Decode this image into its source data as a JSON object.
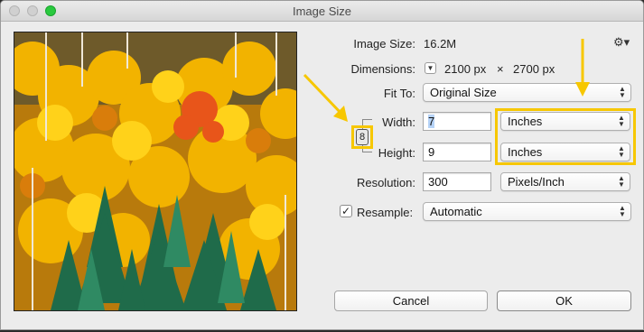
{
  "window": {
    "title": "Image Size"
  },
  "info": {
    "image_size_label": "Image Size:",
    "image_size_value": "16.2M",
    "dimensions_label": "Dimensions:",
    "dimensions_width": "2100 px",
    "dimensions_times": "×",
    "dimensions_height": "2700 px"
  },
  "fit_to": {
    "label": "Fit To:",
    "value": "Original Size"
  },
  "width": {
    "label": "Width:",
    "value": "7",
    "unit": "Inches"
  },
  "height": {
    "label": "Height:",
    "value": "9",
    "unit": "Inches"
  },
  "resolution": {
    "label": "Resolution:",
    "value": "300",
    "unit": "Pixels/Inch"
  },
  "resample": {
    "label": "Resample:",
    "checked": true,
    "value": "Automatic"
  },
  "buttons": {
    "cancel": "Cancel",
    "ok": "OK"
  },
  "colors": {
    "highlight": "#f7c700",
    "selection": "#b6d3f7"
  },
  "icons": {
    "gear": "gear-icon",
    "dimensions_menu": "triangle-down-icon",
    "constrain": "chain-link-icon",
    "select": "up-down-chevron-icon",
    "check": "checkmark-icon"
  }
}
